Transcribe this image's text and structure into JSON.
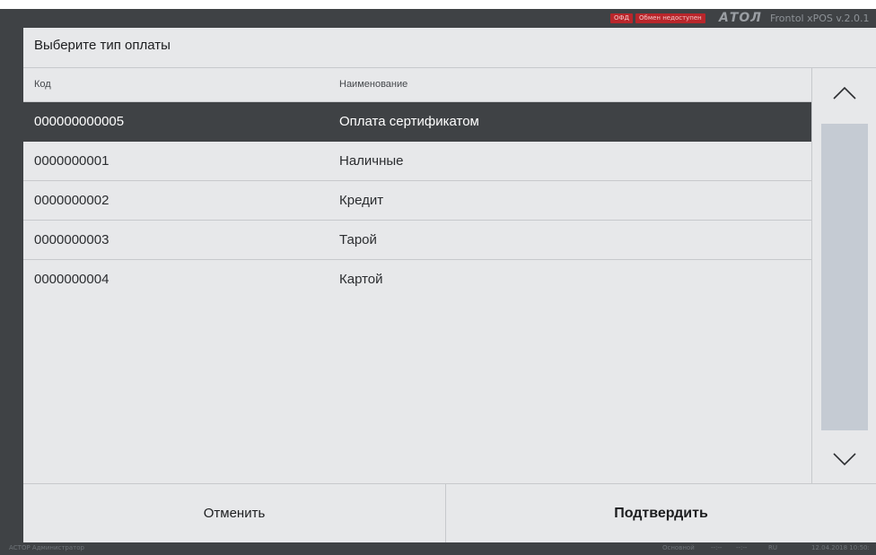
{
  "topbar": {
    "badge_ofd": "ОФД",
    "badge_exchange": "Обмен недоступен",
    "logo": "АТОЛ",
    "version": "Frontol xPOS v.2.0.1"
  },
  "dialog": {
    "title": "Выберите тип оплаты",
    "columns": {
      "code": "Код",
      "name": "Наименование"
    },
    "rows": [
      {
        "code": "000000000005",
        "name": "Оплата сертификатом",
        "selected": true
      },
      {
        "code": "0000000001",
        "name": "Наличные",
        "selected": false
      },
      {
        "code": "0000000002",
        "name": "Кредит",
        "selected": false
      },
      {
        "code": "0000000003",
        "name": "Тарой",
        "selected": false
      },
      {
        "code": "0000000004",
        "name": "Картой",
        "selected": false
      }
    ],
    "cancel_label": "Отменить",
    "confirm_label": "Подтвердить"
  },
  "statusbar": {
    "user": "АСТОР  Администратор",
    "mode": "Основной",
    "time1": "--:--",
    "time2": "--:--",
    "lang": "RU",
    "datetime": "12.04.2018 10:50:"
  },
  "icons": {
    "scroll_up": "chevron-up-icon",
    "scroll_down": "chevron-down-icon"
  },
  "colors": {
    "selected_row": "#3f4245",
    "badge": "#b9262b",
    "scroll_track": "#c5cbd3"
  }
}
